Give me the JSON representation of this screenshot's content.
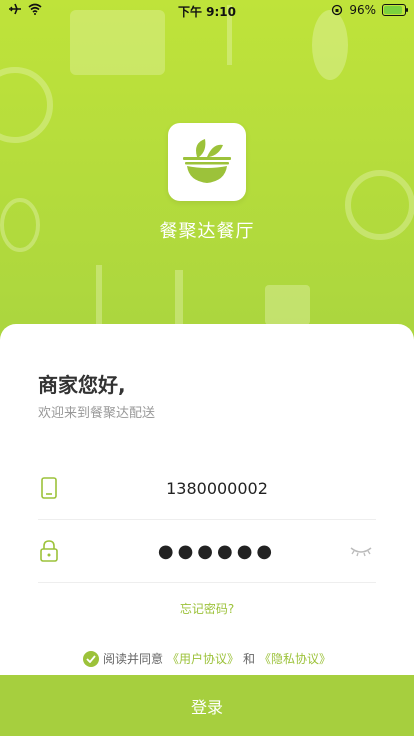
{
  "status_bar": {
    "time": "下午 9:10",
    "battery_percent": "96%",
    "battery_level": 0.96
  },
  "app": {
    "name": "餐聚达餐厅",
    "logo_icon": "salad-bowl-icon"
  },
  "login": {
    "greeting": "商家您好,",
    "subtitle": "欢迎来到餐聚达配送",
    "phone_value": "1380000002",
    "password_mask": "●●●●●●",
    "forgot": "忘记密码?",
    "agree_prefix": "阅读并同意",
    "user_agreement": "《用户协议》",
    "and": "和",
    "privacy_agreement": "《隐私协议》",
    "button": "登录"
  },
  "colors": {
    "accent": "#9cc23a",
    "background": "#bfe33a"
  }
}
